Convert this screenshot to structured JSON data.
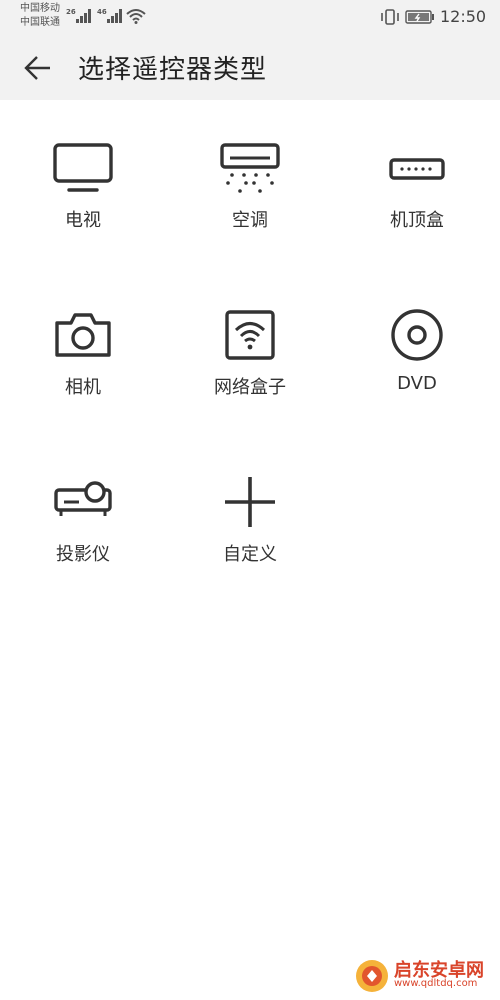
{
  "status_bar": {
    "carrier_1": "中国移动",
    "carrier_2": "中国联通",
    "net_1": "26",
    "net_2": "46",
    "time": "12:50"
  },
  "header": {
    "title": "选择遥控器类型",
    "back_icon": "arrow-left-icon"
  },
  "remote_types": [
    {
      "label": "电视",
      "icon": "tv-icon"
    },
    {
      "label": "空调",
      "icon": "air-conditioner-icon"
    },
    {
      "label": "机顶盒",
      "icon": "set-top-box-icon"
    },
    {
      "label": "相机",
      "icon": "camera-icon"
    },
    {
      "label": "网络盒子",
      "icon": "network-box-icon"
    },
    {
      "label": "DVD",
      "icon": "disc-icon"
    },
    {
      "label": "投影仪",
      "icon": "projector-icon"
    },
    {
      "label": "自定义",
      "icon": "plus-icon"
    }
  ],
  "watermark": {
    "title": "启东安卓网",
    "url": "www.qdltdq.com"
  },
  "colors": {
    "header_bg": "#f2f2f2",
    "icon": "#333333",
    "watermark": "#d9442a"
  }
}
